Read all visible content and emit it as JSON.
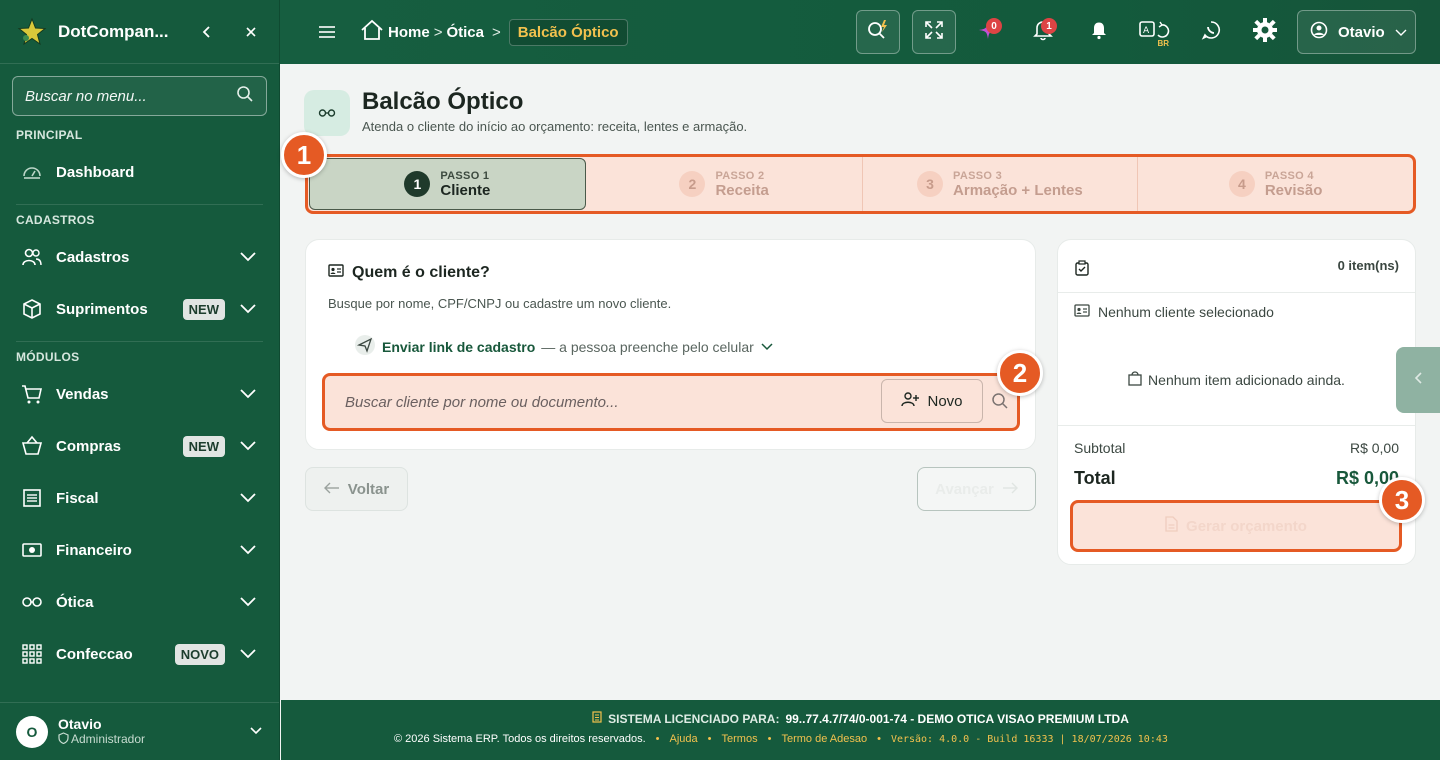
{
  "sidebar": {
    "brand": "DotCompan...",
    "search_placeholder": "Buscar no menu...",
    "sections": {
      "principal": "PRINCIPAL",
      "cadastros": "CADASTROS",
      "modulos": "MÓDULOS"
    },
    "items": [
      {
        "label": "Dashboard",
        "icon": "dashboard-icon"
      },
      {
        "label": "Cadastros",
        "icon": "users-icon"
      },
      {
        "label": "Suprimentos",
        "icon": "box-icon",
        "badge": "NEW"
      },
      {
        "label": "Vendas",
        "icon": "cart-icon"
      },
      {
        "label": "Compras",
        "icon": "basket-icon",
        "badge": "NEW"
      },
      {
        "label": "Fiscal",
        "icon": "receipt-icon"
      },
      {
        "label": "Financeiro",
        "icon": "money-icon"
      },
      {
        "label": "Ótica",
        "icon": "glasses-icon"
      },
      {
        "label": "Confeccao",
        "icon": "grid-icon",
        "badge": "NOVO"
      }
    ],
    "user": {
      "initial": "O",
      "name": "Otavio",
      "role": "Administrador"
    }
  },
  "topbar": {
    "breadcrumb": {
      "home": "Home",
      "otica": "Ótica",
      "current": "Balcão Óptico"
    },
    "badges": {
      "ai": "0",
      "notifications": "1"
    },
    "lang": "BR",
    "user": "Otavio"
  },
  "page": {
    "title": "Balcão Óptico",
    "subtitle": "Atenda o cliente do início ao orçamento: receita, lentes e armação.",
    "steps": [
      {
        "num": "1",
        "kicker": "PASSO 1",
        "name": "Cliente"
      },
      {
        "num": "2",
        "kicker": "PASSO 2",
        "name": "Receita"
      },
      {
        "num": "3",
        "kicker": "PASSO 3",
        "name": "Armação + Lentes"
      },
      {
        "num": "4",
        "kicker": "PASSO 4",
        "name": "Revisão"
      }
    ],
    "client_card": {
      "title": "Quem é o cliente?",
      "subtitle": "Busque por nome, CPF/CNPJ ou cadastre um novo cliente.",
      "send_link": "Enviar link de cadastro",
      "send_hint": "— a pessoa preenche pelo celular",
      "search_placeholder": "Buscar cliente por nome ou documento...",
      "new_button": "Novo"
    },
    "nav": {
      "back": "Voltar",
      "next": "Avançar"
    },
    "summary": {
      "items_count": "0 item(ns)",
      "no_client": "Nenhum cliente selecionado",
      "no_items": "Nenhum item adicionado ainda.",
      "subtotal_label": "Subtotal",
      "subtotal_value": "R$ 0,00",
      "total_label": "Total",
      "total_value": "R$ 0,00",
      "generate": "Gerar orçamento"
    },
    "markers": [
      "1",
      "2",
      "3"
    ]
  },
  "footer": {
    "license_label": "SISTEMA LICENCIADO PARA:",
    "license_value": "99..77.4.7/74/0-001-74 - DEMO OTICA VISAO PREMIUM LTDA",
    "copyright": "© 2026 Sistema ERP. Todos os direitos reservados.",
    "links": [
      "Ajuda",
      "Termos",
      "Termo de Adesao"
    ],
    "version": "Versão: 4.0.0 - Build 16333 | 18/07/2026 10:43"
  },
  "colors": {
    "primary": "#155a3d",
    "accent": "#f2c14e",
    "highlight": "#e55a24"
  }
}
